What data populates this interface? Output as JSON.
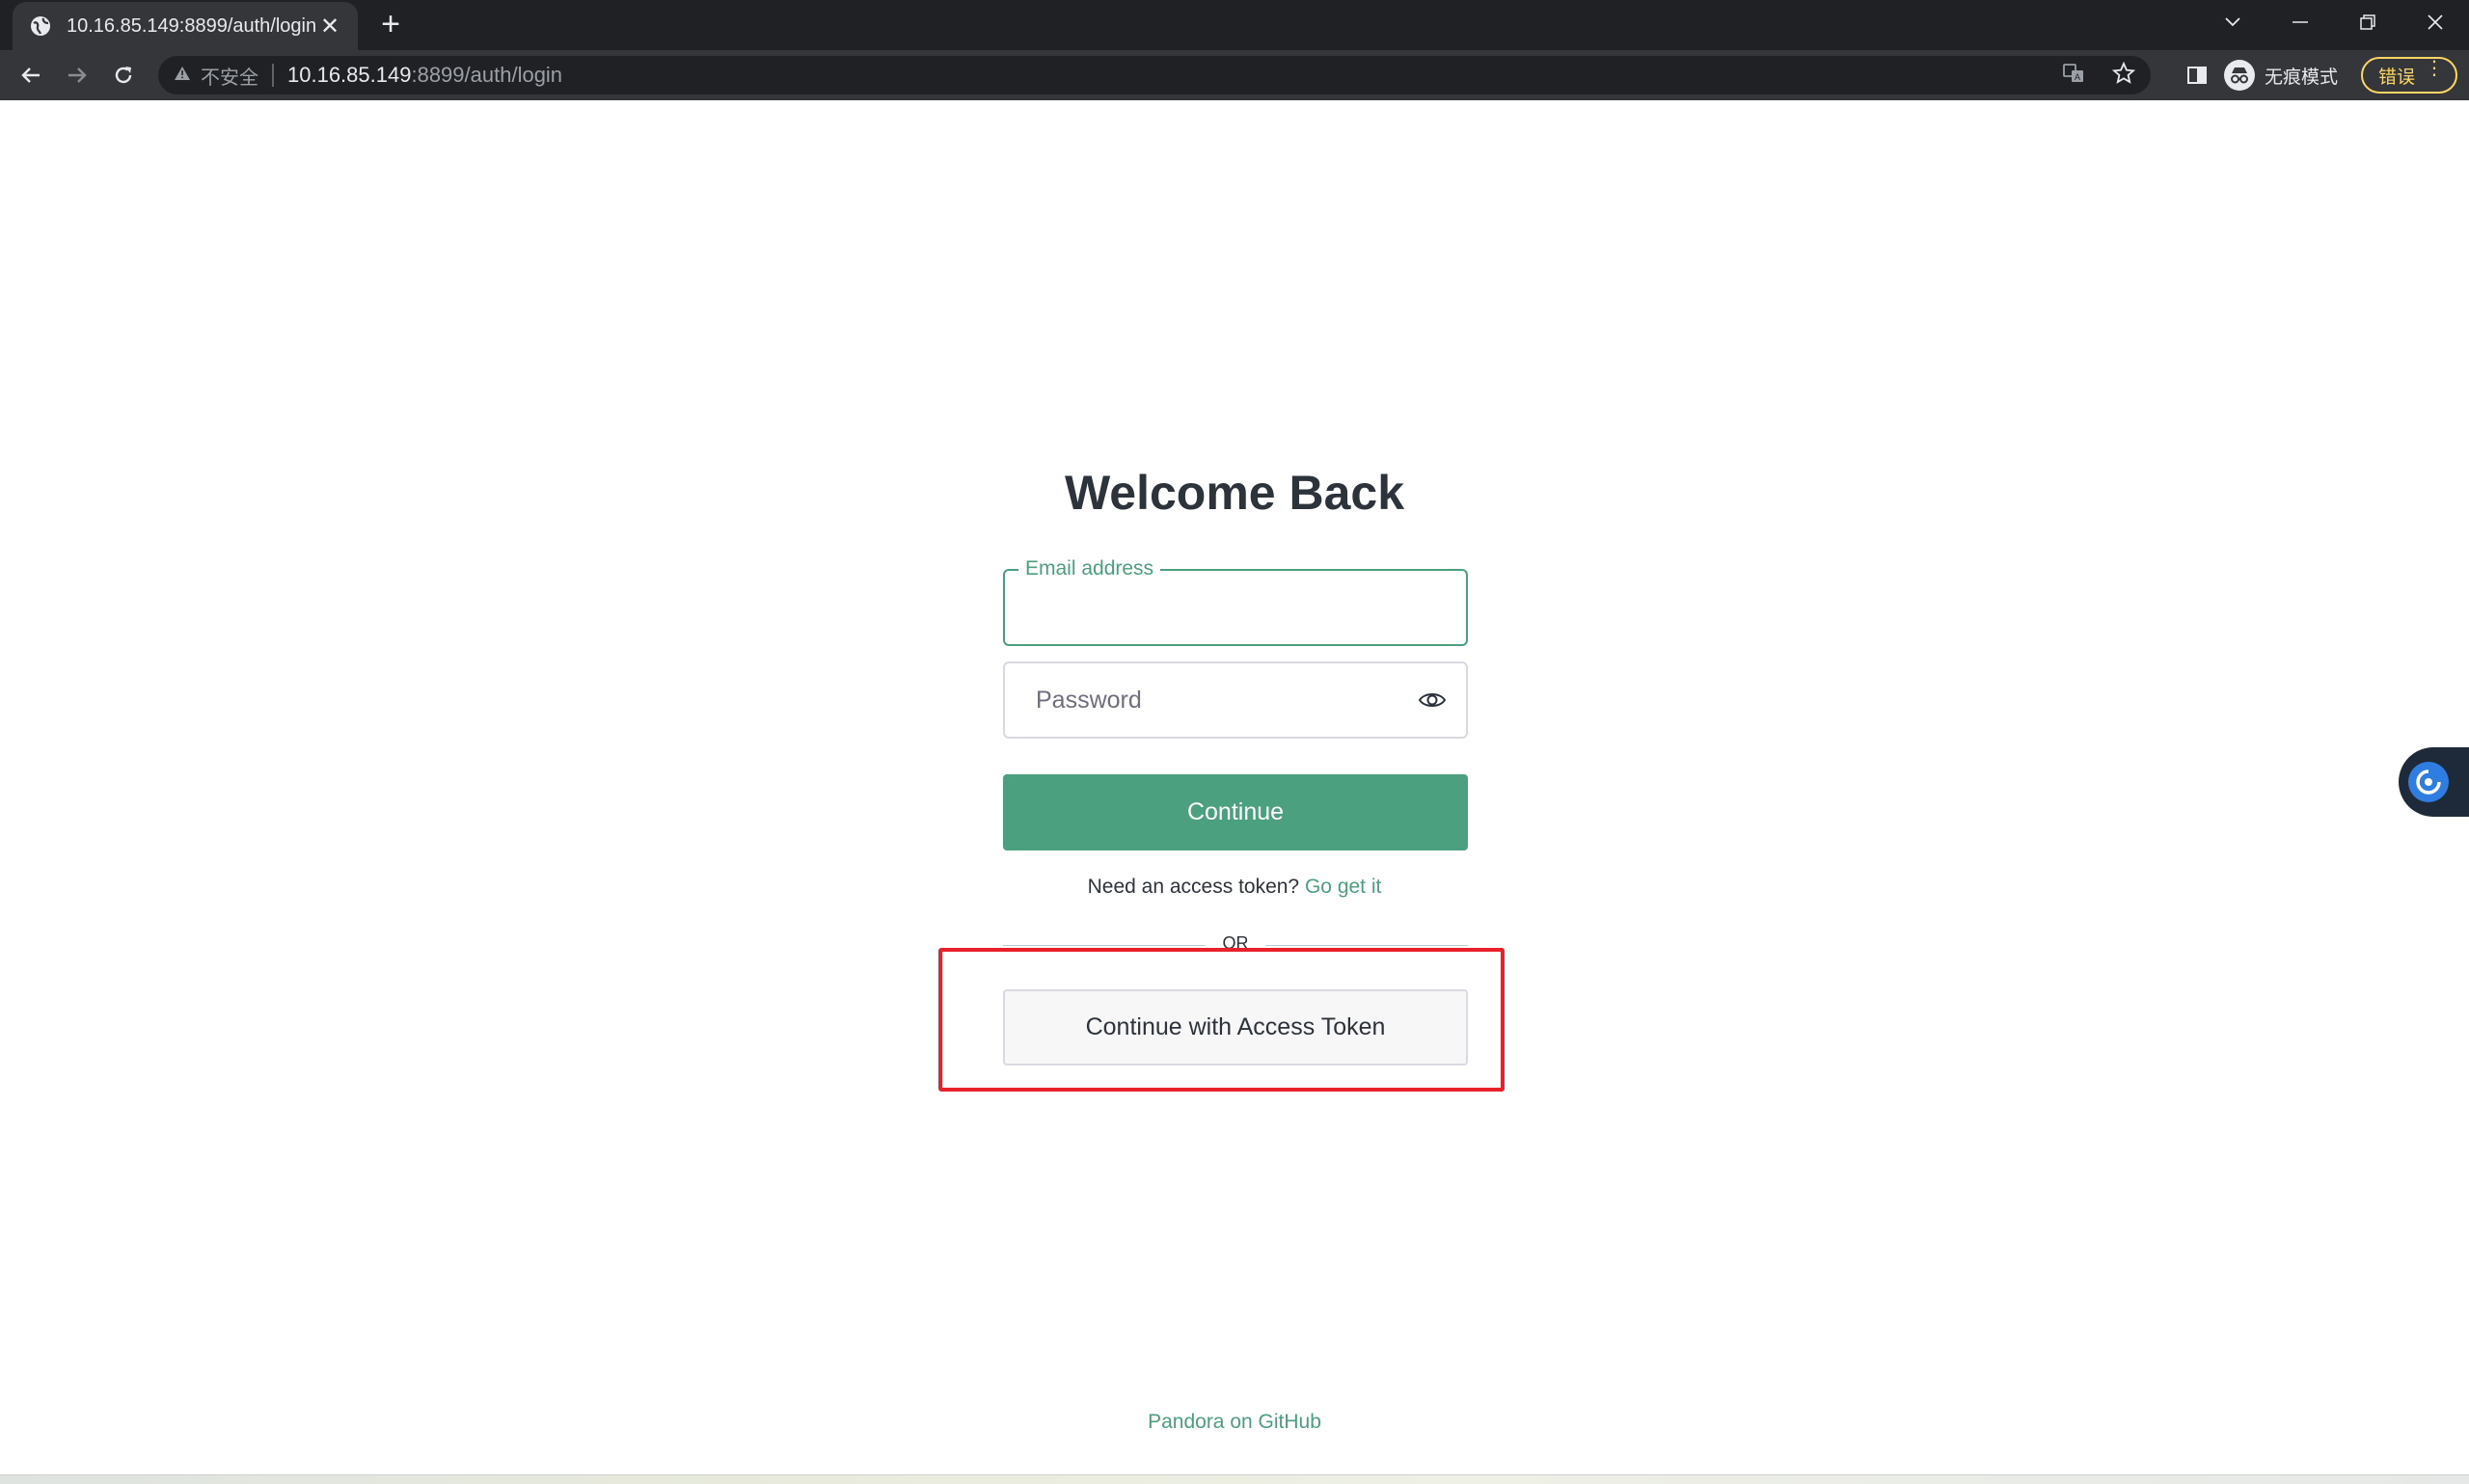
{
  "browser": {
    "tab_title": "10.16.85.149:8899/auth/login",
    "new_tab_symbol": "+",
    "close_tab_symbol": "✕",
    "security_label": "不安全",
    "url_host": "10.16.85.149",
    "url_rest": ":8899/auth/login",
    "incognito_label": "无痕模式",
    "error_label": "错误"
  },
  "page": {
    "title": "Welcome Back",
    "email_label": "Email address",
    "password_placeholder": "Password",
    "continue_label": "Continue",
    "need_token_text": "Need an access token?",
    "go_get_it_label": "Go get it",
    "or_text": "OR",
    "access_token_button_label": "Continue with Access Token",
    "footer_link_label": "Pandora on GitHub"
  },
  "colors": {
    "accent": "#4aa07f",
    "highlight": "#e8202a",
    "chrome_dark": "#202124"
  }
}
